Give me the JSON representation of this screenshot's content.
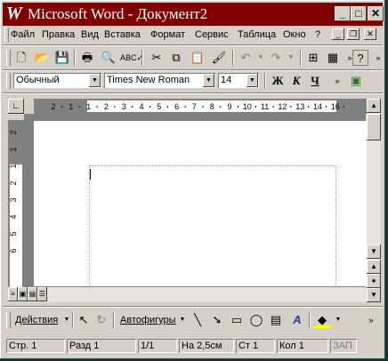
{
  "window": {
    "title": "Microsoft Word - Документ2",
    "app_icon": "W"
  },
  "menu": {
    "items": [
      {
        "label": "Файл"
      },
      {
        "label": "Правка"
      },
      {
        "label": "Вид"
      },
      {
        "label": "Вставка"
      },
      {
        "label": "Формат"
      },
      {
        "label": "Сервис"
      },
      {
        "label": "Таблица"
      },
      {
        "label": "Окно"
      },
      {
        "label": "?"
      }
    ]
  },
  "format": {
    "style": "Обычный",
    "font": "Times New Roman",
    "size": "14",
    "bold": "Ж",
    "italic": "К",
    "underline": "Ч"
  },
  "ruler": {
    "h_numbers": [
      "2",
      "1",
      "1",
      "2",
      "3",
      "4",
      "5",
      "6",
      "7",
      "8",
      "9",
      "10",
      "11",
      "12",
      "13",
      "14",
      "16"
    ],
    "v_numbers": [
      "2",
      "1",
      "1",
      "2",
      "3",
      "4",
      "5",
      "6"
    ]
  },
  "drawing": {
    "actions": "Действия",
    "autoshapes": "Автофигуры"
  },
  "status": {
    "page": "Стр. 1",
    "section": "Разд 1",
    "pages": "1/1",
    "at": "На 2,5см",
    "line": "Ст 1",
    "col": "Кол 1",
    "rec": "ЗАП"
  },
  "colors": {
    "titlebar": "#800000",
    "chrome": "#d4d0c8"
  }
}
